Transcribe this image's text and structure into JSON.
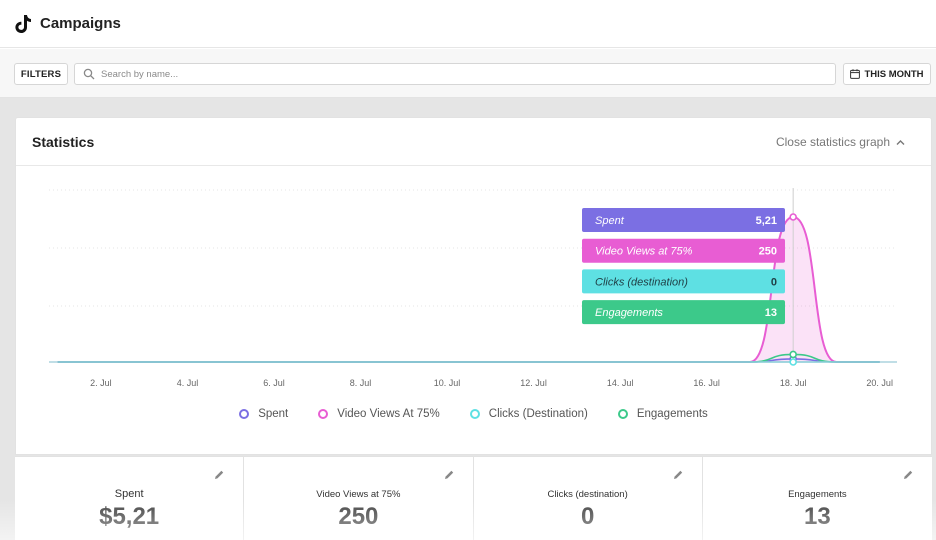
{
  "header": {
    "title": "Campaigns",
    "logo_icon": "tiktok-logo-icon"
  },
  "toolbar": {
    "filters_label": "FILTERS",
    "search_placeholder": "Search by name...",
    "search_value": "",
    "date_range_label": "THIS MONTH"
  },
  "statistics": {
    "title": "Statistics",
    "close_label": "Close statistics graph"
  },
  "tooltip": {
    "items": [
      {
        "label": "Spent",
        "value": "5,21",
        "color": "#7b6fe3"
      },
      {
        "label": "Video Views at 75%",
        "value": "250",
        "color": "#e85dd3"
      },
      {
        "label": "Clicks (destination)",
        "value": "0",
        "color": "#5ee0e3"
      },
      {
        "label": "Engagements",
        "value": "13",
        "color": "#3cc98a"
      }
    ]
  },
  "chart_data": {
    "type": "area",
    "x_ticks": [
      "2. Jul",
      "4. Jul",
      "6. Jul",
      "8. Jul",
      "10. Jul",
      "12. Jul",
      "14. Jul",
      "16. Jul",
      "18. Jul",
      "20. Jul"
    ],
    "x": [
      1,
      2,
      3,
      4,
      5,
      6,
      7,
      8,
      9,
      10,
      11,
      12,
      13,
      14,
      15,
      16,
      17,
      18,
      19,
      20
    ],
    "xlim": [
      0.8,
      20.4
    ],
    "ylim": [
      0,
      300
    ],
    "grid": true,
    "series": [
      {
        "name": "Spent",
        "color": "#7b6fe3",
        "values": [
          0,
          0,
          0,
          0,
          0,
          0,
          0,
          0,
          0,
          0,
          0,
          0,
          0,
          0,
          0,
          0,
          0,
          5.21,
          0,
          0
        ]
      },
      {
        "name": "Video Views At 75%",
        "color": "#e85dd3",
        "values": [
          0,
          0,
          0,
          0,
          0,
          0,
          0,
          0,
          0,
          0,
          0,
          0,
          0,
          0,
          0,
          0,
          0,
          250,
          0,
          0
        ]
      },
      {
        "name": "Clicks (Destination)",
        "color": "#5ee0e3",
        "values": [
          0,
          0,
          0,
          0,
          0,
          0,
          0,
          0,
          0,
          0,
          0,
          0,
          0,
          0,
          0,
          0,
          0,
          0,
          0,
          0
        ]
      },
      {
        "name": "Engagements",
        "color": "#3cc98a",
        "values": [
          0,
          0,
          0,
          0,
          0,
          0,
          0,
          0,
          0,
          0,
          0,
          0,
          0,
          0,
          0,
          0,
          0,
          13,
          0,
          0
        ]
      }
    ],
    "highlight_x": 18,
    "legend_position": "bottom"
  },
  "legend": [
    {
      "label": "Spent",
      "color": "#7b6fe3"
    },
    {
      "label": "Video Views At 75%",
      "color": "#e85dd3"
    },
    {
      "label": "Clicks (Destination)",
      "color": "#5ee0e3"
    },
    {
      "label": "Engagements",
      "color": "#3cc98a"
    }
  ],
  "kpis": [
    {
      "label": "Spent",
      "value": "$5,21"
    },
    {
      "label": "Video Views at 75%",
      "value": "250"
    },
    {
      "label": "Clicks (destination)",
      "value": "0"
    },
    {
      "label": "Engagements",
      "value": "13"
    }
  ]
}
